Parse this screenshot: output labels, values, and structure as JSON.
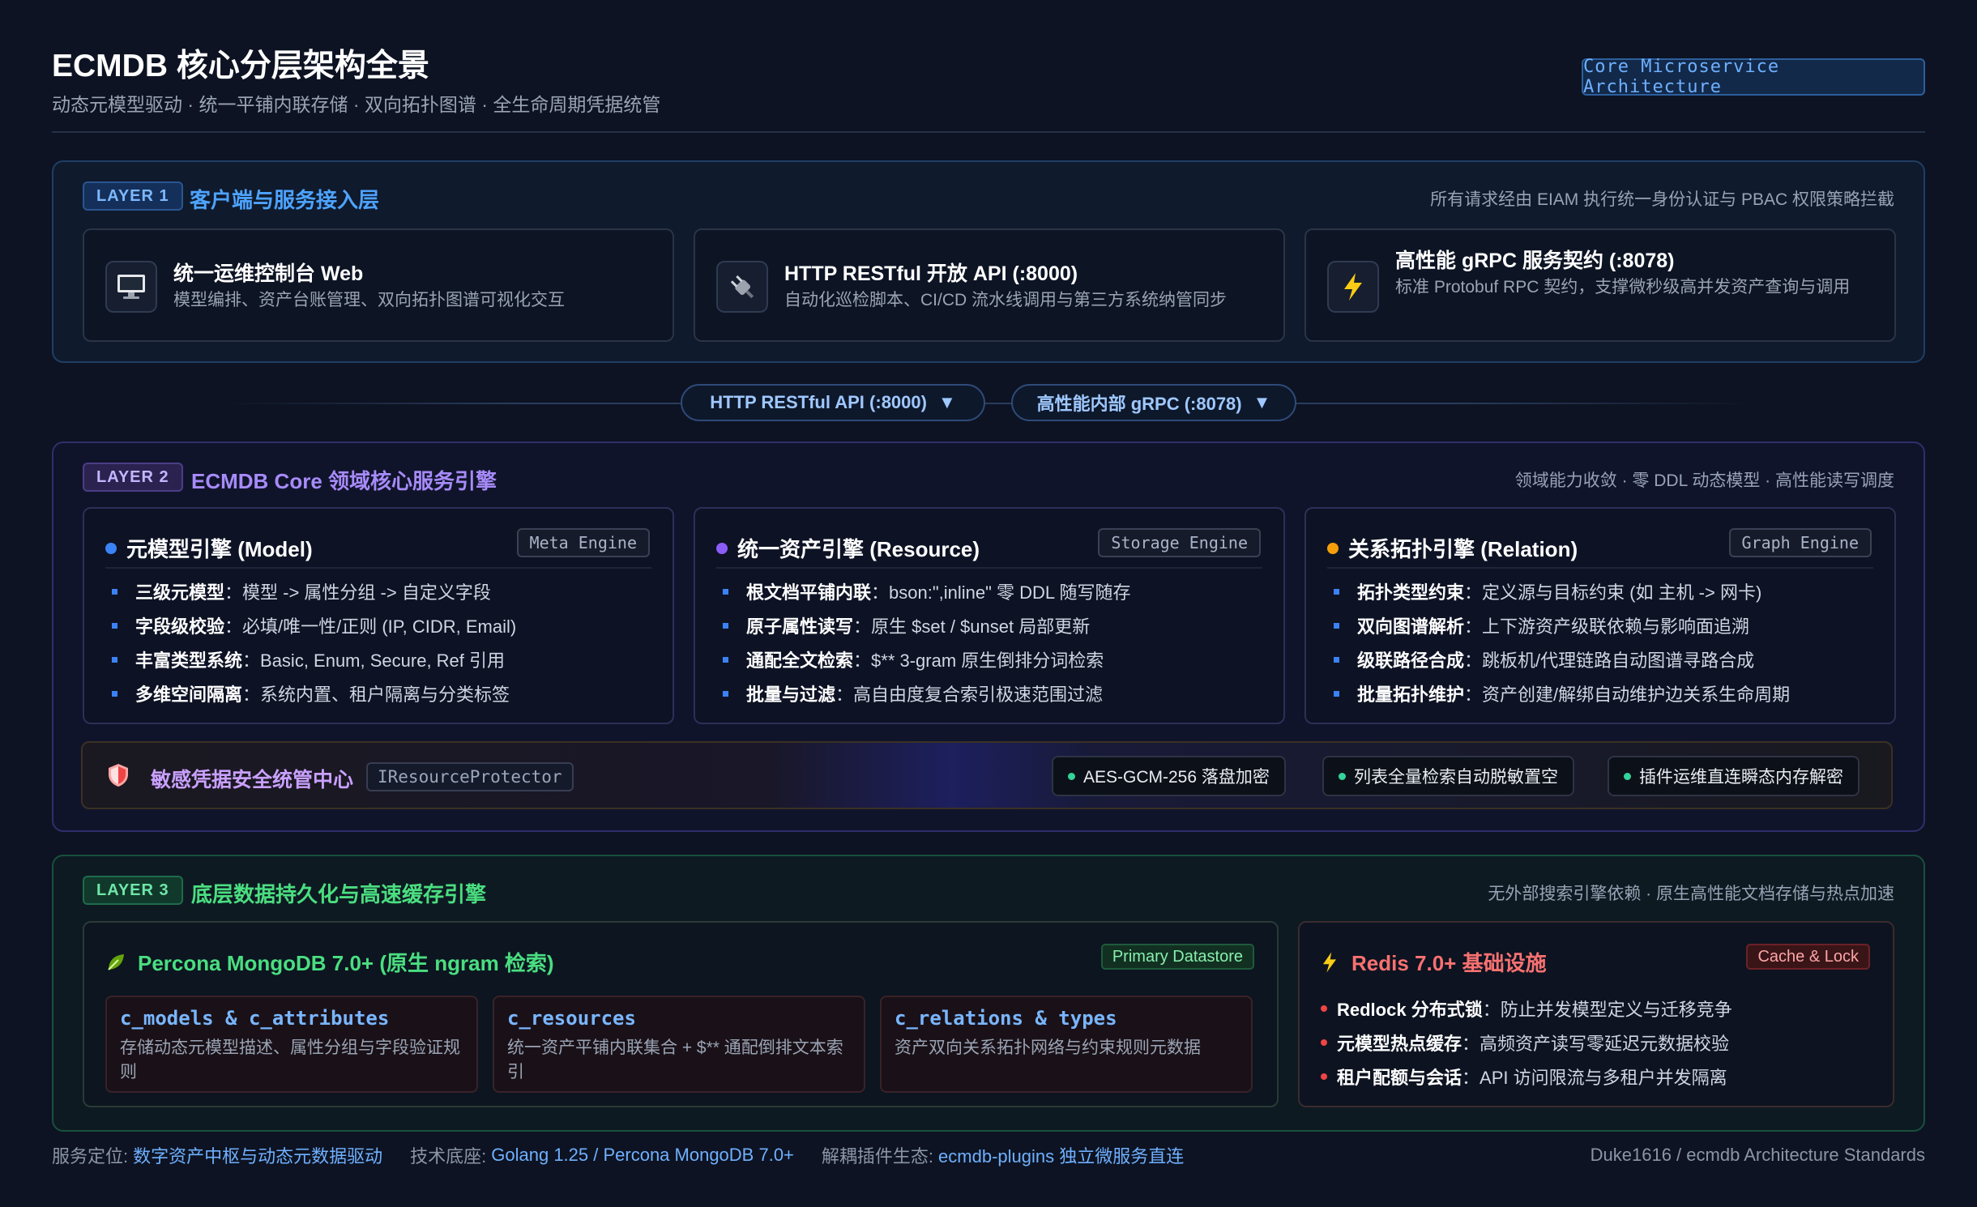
{
  "header": {
    "title": "ECMDB 核心分层架构全景",
    "subtitle": "动态元模型驱动 · 统一平铺内联存储 · 双向拓扑图谱 · 全生命周期凭据统管",
    "badge": "Core Microservice Architecture"
  },
  "layer1": {
    "tag": "LAYER 1",
    "title": "客户端与服务接入层",
    "note": "所有请求经由 EIAM 执行统一身份认证与 PBAC 权限策略拦截",
    "cards": [
      {
        "icon": "monitor-icon",
        "title": "统一运维控制台 Web",
        "desc": "模型编排、资产台账管理、双向拓扑图谱可视化交互"
      },
      {
        "icon": "plug-icon",
        "title": "HTTP RESTful 开放 API (:8000)",
        "desc": "自动化巡检脚本、CI/CD 流水线调用与第三方系统纳管同步"
      },
      {
        "icon": "lightning-icon",
        "title": "高性能 gRPC 服务契约 (:8078)",
        "desc": "标准 Protobuf RPC 契约，支撑微秒级高并发资产查询与调用"
      }
    ]
  },
  "connectors": {
    "http": "HTTP RESTful API (:8000)",
    "grpc": "高性能内部 gRPC (:8078)",
    "arrow": "▼"
  },
  "layer2": {
    "tag": "LAYER 2",
    "title": "ECMDB Core 领域核心服务引擎",
    "note": "领域能力收敛 · 零 DDL 动态模型 · 高性能读写调度",
    "engines": [
      {
        "title": "元模型引擎 (Model)",
        "tag": "Meta Engine",
        "dot": "#3b82f6",
        "items": [
          {
            "k": "三级元模型",
            "v": "：模型 -> 属性分组 -> 自定义字段"
          },
          {
            "k": "字段级校验",
            "v": "：必填/唯一性/正则 (IP, CIDR, Email)"
          },
          {
            "k": "丰富类型系统",
            "v": "：Basic, Enum, Secure, Ref 引用"
          },
          {
            "k": "多维空间隔离",
            "v": "：系统内置、租户隔离与分类标签"
          }
        ]
      },
      {
        "title": "统一资产引擎 (Resource)",
        "tag": "Storage Engine",
        "dot": "#8b5cf6",
        "items": [
          {
            "k": "根文档平铺内联",
            "v": "：bson:\",inline\" 零 DDL 随写随存"
          },
          {
            "k": "原子属性读写",
            "v": "：原生 $set / $unset 局部更新"
          },
          {
            "k": "通配全文检索",
            "v": "：$** 3-gram 原生倒排分词检索"
          },
          {
            "k": "批量与过滤",
            "v": "：高自由度复合索引极速范围过滤"
          }
        ]
      },
      {
        "title": "关系拓扑引擎 (Relation)",
        "tag": "Graph Engine",
        "dot": "#f59e0b",
        "items": [
          {
            "k": "拓扑类型约束",
            "v": "：定义源与目标约束 (如 主机 -> 网卡)"
          },
          {
            "k": "双向图谱解析",
            "v": "：上下游资产级联依赖与影响面追溯"
          },
          {
            "k": "级联路径合成",
            "v": "：跳板机/代理链路自动图谱寻路合成"
          },
          {
            "k": "批量拓扑维护",
            "v": "：资产创建/解绑自动维护边关系生命周期"
          }
        ]
      }
    ],
    "security": {
      "icon": "shield-icon",
      "title": "敏感凭据安全统管中心",
      "interface": "IResourceProtector",
      "pills": [
        "AES-GCM-256 落盘加密",
        "列表全量检索自动脱敏置空",
        "插件运维直连瞬态内存解密"
      ]
    }
  },
  "layer3": {
    "tag": "LAYER 3",
    "title": "底层数据持久化与高速缓存引擎",
    "note": "无外部搜索引擎依赖 · 原生高性能文档存储与热点加速",
    "mongo": {
      "icon": "leaf-icon",
      "title": "Percona MongoDB 7.0+ (原生 ngram 检索)",
      "tag": "Primary Datastore",
      "collections": [
        {
          "name": "c_models & c_attributes",
          "desc": "存储动态元模型描述、属性分组与字段验证规则"
        },
        {
          "name": "c_resources",
          "desc": "统一资产平铺内联集合 + $** 通配倒排文本索引"
        },
        {
          "name": "c_relations & types",
          "desc": "资产双向关系拓扑网络与约束规则元数据"
        }
      ]
    },
    "redis": {
      "icon": "lightning-icon",
      "title": "Redis 7.0+ 基础设施",
      "tag": "Cache & Lock",
      "items": [
        {
          "k": "Redlock 分布式锁",
          "v": "：防止并发模型定义与迁移竞争"
        },
        {
          "k": "元模型热点缓存",
          "v": "：高频资产读写零延迟元数据校验"
        },
        {
          "k": "租户配额与会话",
          "v": "：API 访问限流与多租户并发隔离"
        }
      ]
    }
  },
  "footer": {
    "pos_label": "服务定位:",
    "pos_value": "数字资产中枢与动态元数据驱动",
    "tech_label": "技术底座:",
    "tech_value": "Golang 1.25 / Percona MongoDB 7.0+",
    "plugin_label": "解耦插件生态:",
    "plugin_value": "ecmdb-plugins 独立微服务直连",
    "credit": "Duke1616 / ecmdb Architecture Standards"
  },
  "colors": {
    "layer1_accent": "#4da3ff",
    "layer2_accent": "#a78bfa",
    "layer3_accent": "#4ade80",
    "redis_accent": "#f87171",
    "background": "#0d1322"
  }
}
